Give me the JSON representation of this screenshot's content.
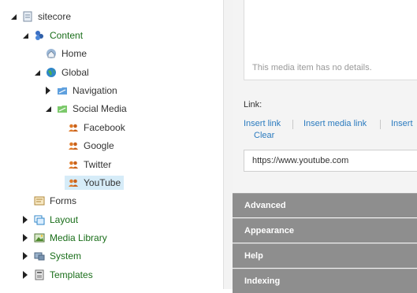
{
  "tree": {
    "items": [
      {
        "label": "sitecore",
        "icon": "page-icon",
        "toggle": "open",
        "color": "dark"
      },
      {
        "label": "Content",
        "icon": "content-people-icon",
        "toggle": "open",
        "color": "green"
      },
      {
        "label": "Home",
        "icon": "home-globe-icon",
        "toggle": "none",
        "color": "dark"
      },
      {
        "label": "Global",
        "icon": "globe-icon",
        "toggle": "open",
        "color": "dark"
      },
      {
        "label": "Navigation",
        "icon": "navigation-folder-icon",
        "toggle": "closed",
        "color": "dark"
      },
      {
        "label": "Social Media",
        "icon": "social-folder-icon",
        "toggle": "open",
        "color": "dark"
      },
      {
        "label": "Facebook",
        "icon": "user-group-icon",
        "toggle": "none",
        "color": "dark"
      },
      {
        "label": "Google",
        "icon": "user-group-icon",
        "toggle": "none",
        "color": "dark"
      },
      {
        "label": "Twitter",
        "icon": "user-group-icon",
        "toggle": "none",
        "color": "dark"
      },
      {
        "label": "YouTube",
        "icon": "user-group-icon",
        "toggle": "none",
        "color": "dark",
        "selected": true
      },
      {
        "label": "Forms",
        "icon": "forms-icon",
        "toggle": "none",
        "color": "dark"
      },
      {
        "label": "Layout",
        "icon": "layout-icon",
        "toggle": "closed",
        "color": "green"
      },
      {
        "label": "Media Library",
        "icon": "media-library-icon",
        "toggle": "closed",
        "color": "green"
      },
      {
        "label": "System",
        "icon": "system-icon",
        "toggle": "closed",
        "color": "green"
      },
      {
        "label": "Templates",
        "icon": "templates-icon",
        "toggle": "closed",
        "color": "green"
      }
    ]
  },
  "details": {
    "message": "This media item has no details."
  },
  "link": {
    "label": "Link:",
    "insert_link": "Insert link",
    "insert_media_link": "Insert media link",
    "insert_more": "Insert",
    "clear": "Clear",
    "value": "https://www.youtube.com"
  },
  "sections": [
    {
      "label": "Advanced"
    },
    {
      "label": "Appearance"
    },
    {
      "label": "Help"
    },
    {
      "label": "Indexing"
    }
  ],
  "colors": {
    "accent_link": "#2b7bbf",
    "tree_green": "#1a6e1a",
    "section_bg": "#8e8e8e",
    "selected_bg": "#d6ecf8"
  }
}
